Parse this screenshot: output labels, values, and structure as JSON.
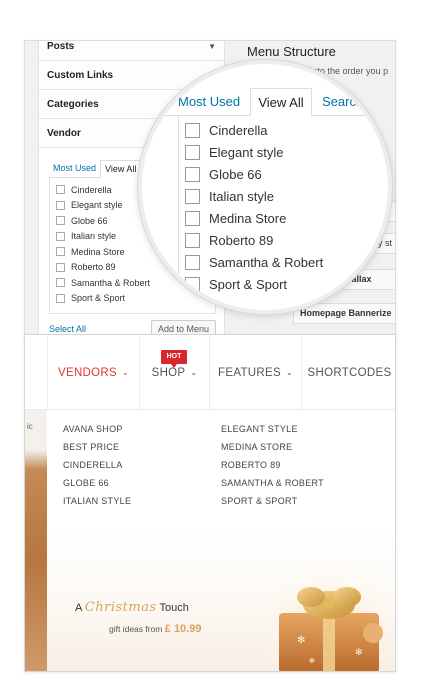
{
  "admin": {
    "accordion": [
      "Posts",
      "Custom Links",
      "Categories",
      "Vendor"
    ],
    "tabs": {
      "most_used": "Most Used",
      "view_all": "View All",
      "search": "Search"
    },
    "vendors": [
      "Cinderella",
      "Elegant style",
      "Globe 66",
      "Italian style",
      "Medina Store",
      "Roberto 89",
      "Samantha & Robert",
      "Sport & Sport"
    ],
    "select_all": "Select All",
    "add_to_menu": "Add to Menu",
    "menu_structure": {
      "title": "Menu Structure",
      "subtitle": "Drag each item into the order you p",
      "items": [
        "act",
        "bay st",
        "Parallax",
        "Homepage Bannerize"
      ]
    }
  },
  "store": {
    "nav": [
      {
        "label": "VENDORS",
        "active": true
      },
      {
        "label": "SHOP",
        "active": false
      },
      {
        "label": "FEATURES",
        "active": false
      },
      {
        "label": "SHORTCODES",
        "active": false
      }
    ],
    "hot_badge": "HOT",
    "dropdown_col1": [
      "AVANA SHOP",
      "BEST PRICE",
      "CINDERELLA",
      "GLOBE 66",
      "ITALIAN STYLE"
    ],
    "dropdown_col2": [
      "ELEGANT STYLE",
      "MEDINA STORE",
      "ROBERTO 89",
      "SAMANTHA & ROBERT",
      "SPORT & SPORT"
    ],
    "promo": {
      "a": "A",
      "christmas": "Christmas",
      "touch": "Touch",
      "gift_text": "gift ideas from",
      "price": "£ 10.99"
    },
    "left_strip_text": "ic"
  },
  "colors": {
    "accent_red": "#d9272e",
    "link_blue": "#0073aa",
    "gold": "#d9a25e"
  }
}
